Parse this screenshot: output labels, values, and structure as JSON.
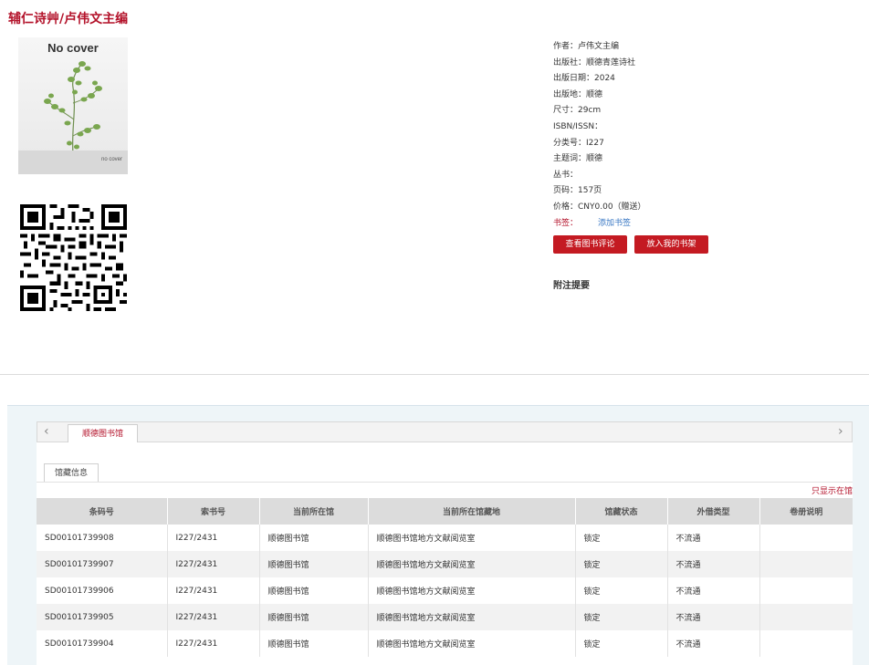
{
  "book": {
    "title": "辅仁诗艸",
    "separator": "/",
    "responsibility": "卢伟文主编"
  },
  "cover": {
    "top_text": "No cover",
    "bottom_text": "no cover"
  },
  "meta": {
    "author": "作者：卢伟文主编",
    "publisher": "出版社：顺德青莲诗社",
    "pub_date": "出版日期：2024",
    "pub_place": "出版地：顺德",
    "size": "尺寸：29cm",
    "isbn": "ISBN/ISSN：",
    "class_no": "分类号：I227",
    "subject": "主题词：顺德",
    "series": "丛书：",
    "pages": "页码：157页",
    "price": "价格：CNY0.00（赠送）",
    "bookmark_label": "书签：",
    "bookmark_link": "添加书签"
  },
  "actions": {
    "review": "查看图书评论",
    "shelf": "放入我的书架"
  },
  "notes_heading": "附注提要",
  "holdings": {
    "tab": "顺德图书馆",
    "subtab": "馆藏信息",
    "show_only": "只显示在馆",
    "columns": [
      "条码号",
      "索书号",
      "当前所在馆",
      "当前所在馆藏地",
      "馆藏状态",
      "外借类型",
      "卷册说明"
    ],
    "rows": [
      [
        "SD00101739908",
        "I227/2431",
        "顺德图书馆",
        "顺德图书馆地方文献阅览室",
        "锁定",
        "不流通",
        ""
      ],
      [
        "SD00101739907",
        "I227/2431",
        "顺德图书馆",
        "顺德图书馆地方文献阅览室",
        "锁定",
        "不流通",
        ""
      ],
      [
        "SD00101739906",
        "I227/2431",
        "顺德图书馆",
        "顺德图书馆地方文献阅览室",
        "锁定",
        "不流通",
        ""
      ],
      [
        "SD00101739905",
        "I227/2431",
        "顺德图书馆",
        "顺德图书馆地方文献阅览室",
        "锁定",
        "不流通",
        ""
      ],
      [
        "SD00101739904",
        "I227/2431",
        "顺德图书馆",
        "顺德图书馆地方文献阅览室",
        "锁定",
        "不流通",
        ""
      ]
    ]
  },
  "colors": {
    "accent_red": "#b3122a",
    "button_red": "#c41a22",
    "link_blue": "#3a78c4"
  }
}
